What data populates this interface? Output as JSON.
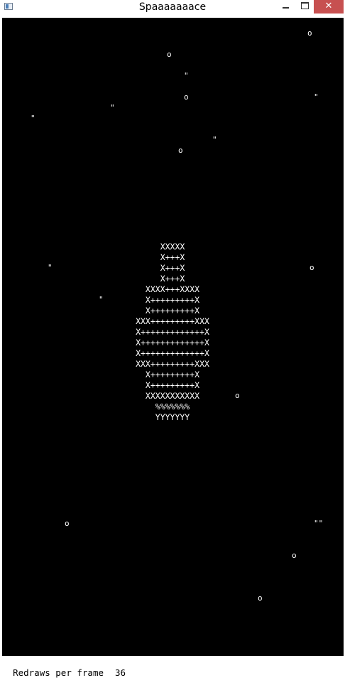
{
  "window": {
    "title": "Spaaaaaaace",
    "close_glyph": "✕"
  },
  "game": {
    "stars": [
      {
        "char": "o"
      },
      {
        "char": "o"
      },
      {
        "char": "\""
      },
      {
        "char": "o"
      },
      {
        "char": "\""
      },
      {
        "char": "\""
      },
      {
        "char": "\""
      },
      {
        "char": "\""
      },
      {
        "char": "o"
      },
      {
        "char": "\""
      },
      {
        "char": "o"
      },
      {
        "char": "\""
      },
      {
        "char": "o"
      },
      {
        "char": "o"
      },
      {
        "char": "\"\""
      },
      {
        "char": "o"
      },
      {
        "char": "o"
      }
    ],
    "ship_rows": [
      "XXXXX",
      "X+++X",
      "X+++X",
      "X+++X",
      "XXXX+++XXXX",
      "X+++++++++X",
      "X+++++++++X",
      "XXX+++++++++XXX",
      "X+++++++++++++X",
      "X+++++++++++++X",
      "X+++++++++++++X",
      "XXX+++++++++XXX",
      "X+++++++++X",
      "X+++++++++X",
      "XXXXXXXXXXX",
      "%%%%%%%",
      "YYYYYYY"
    ]
  },
  "status": {
    "label": "Redraws per frame",
    "value": "36"
  }
}
